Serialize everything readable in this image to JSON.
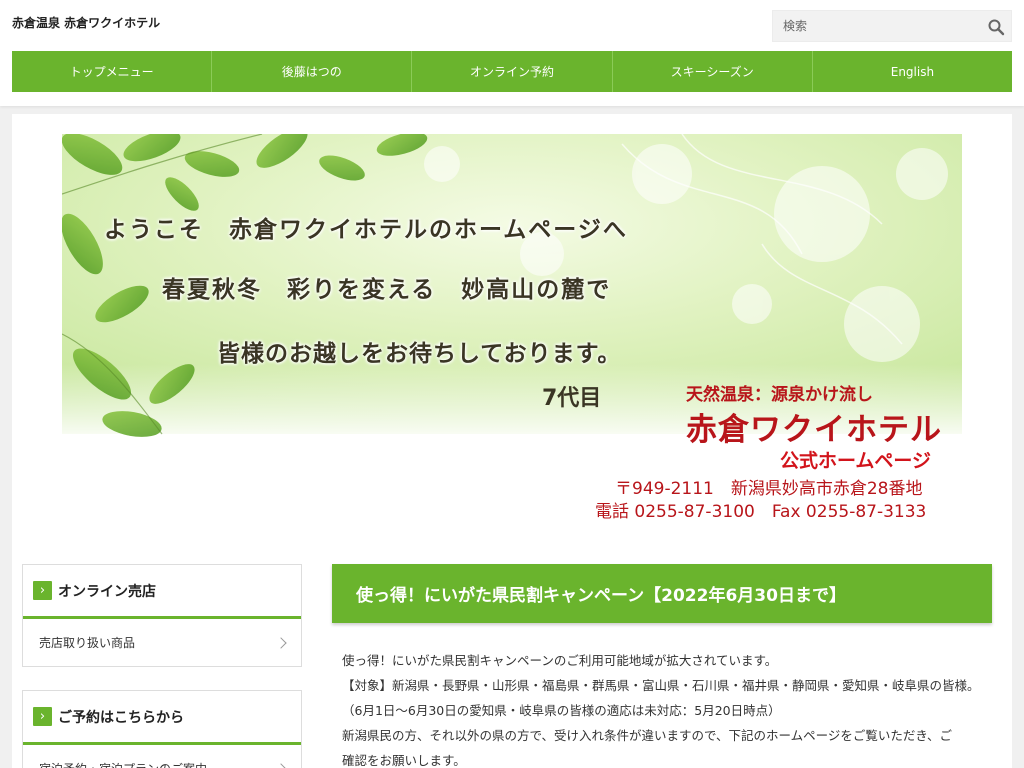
{
  "header": {
    "site_title": "赤倉温泉 赤倉ワクイホテル",
    "search_placeholder": "検索"
  },
  "nav": {
    "items": [
      "トップメニュー",
      "後藤はつの",
      "オンライン予約",
      "スキーシーズン",
      "English"
    ]
  },
  "hero": {
    "line1": "ようこそ　赤倉ワクイホテルのホームページへ",
    "line2": "春夏秋冬　彩りを変える　妙高山の麓で",
    "line3": "皆様のお越しをお待ちしております。",
    "generation": "7代目",
    "onsen": "天然温泉：源泉かけ流し",
    "hotel_name": "赤倉ワクイホテル",
    "official": "公式ホームページ",
    "address": "〒949-2111　新潟県妙高市赤倉28番地",
    "phone": "電話 0255-87-3100　Fax 0255-87-3133"
  },
  "sidebar": {
    "widgets": [
      {
        "title": "オンライン売店",
        "link": "売店取り扱い商品"
      },
      {
        "title": "ご予約はこちらから",
        "link": "宿泊予約・宿泊プランのご案内"
      }
    ]
  },
  "post": {
    "title": "使っ得！にいがた県民割キャンペーン【2022年6月30日まで】",
    "lines": [
      "使っ得！にいがた県民割キャンペーンのご利用可能地域が拡大されています。",
      "【対象】新潟県・長野県・山形県・福島県・群馬県・富山県・石川県・福井県・静岡県・愛知県・岐阜県の皆様。",
      "（6月1日～6月30日の愛知県・岐阜県の皆様の適応は未対応：5月20日時点）",
      "新潟県民の方、それ以外の県の方で、受け入れ条件が違いますので、下記のホームページをご覧いただき、ご",
      "確認をお願いします。"
    ]
  },
  "colors": {
    "accent": "#6ab42d",
    "hotel_red": "#b8151a"
  }
}
